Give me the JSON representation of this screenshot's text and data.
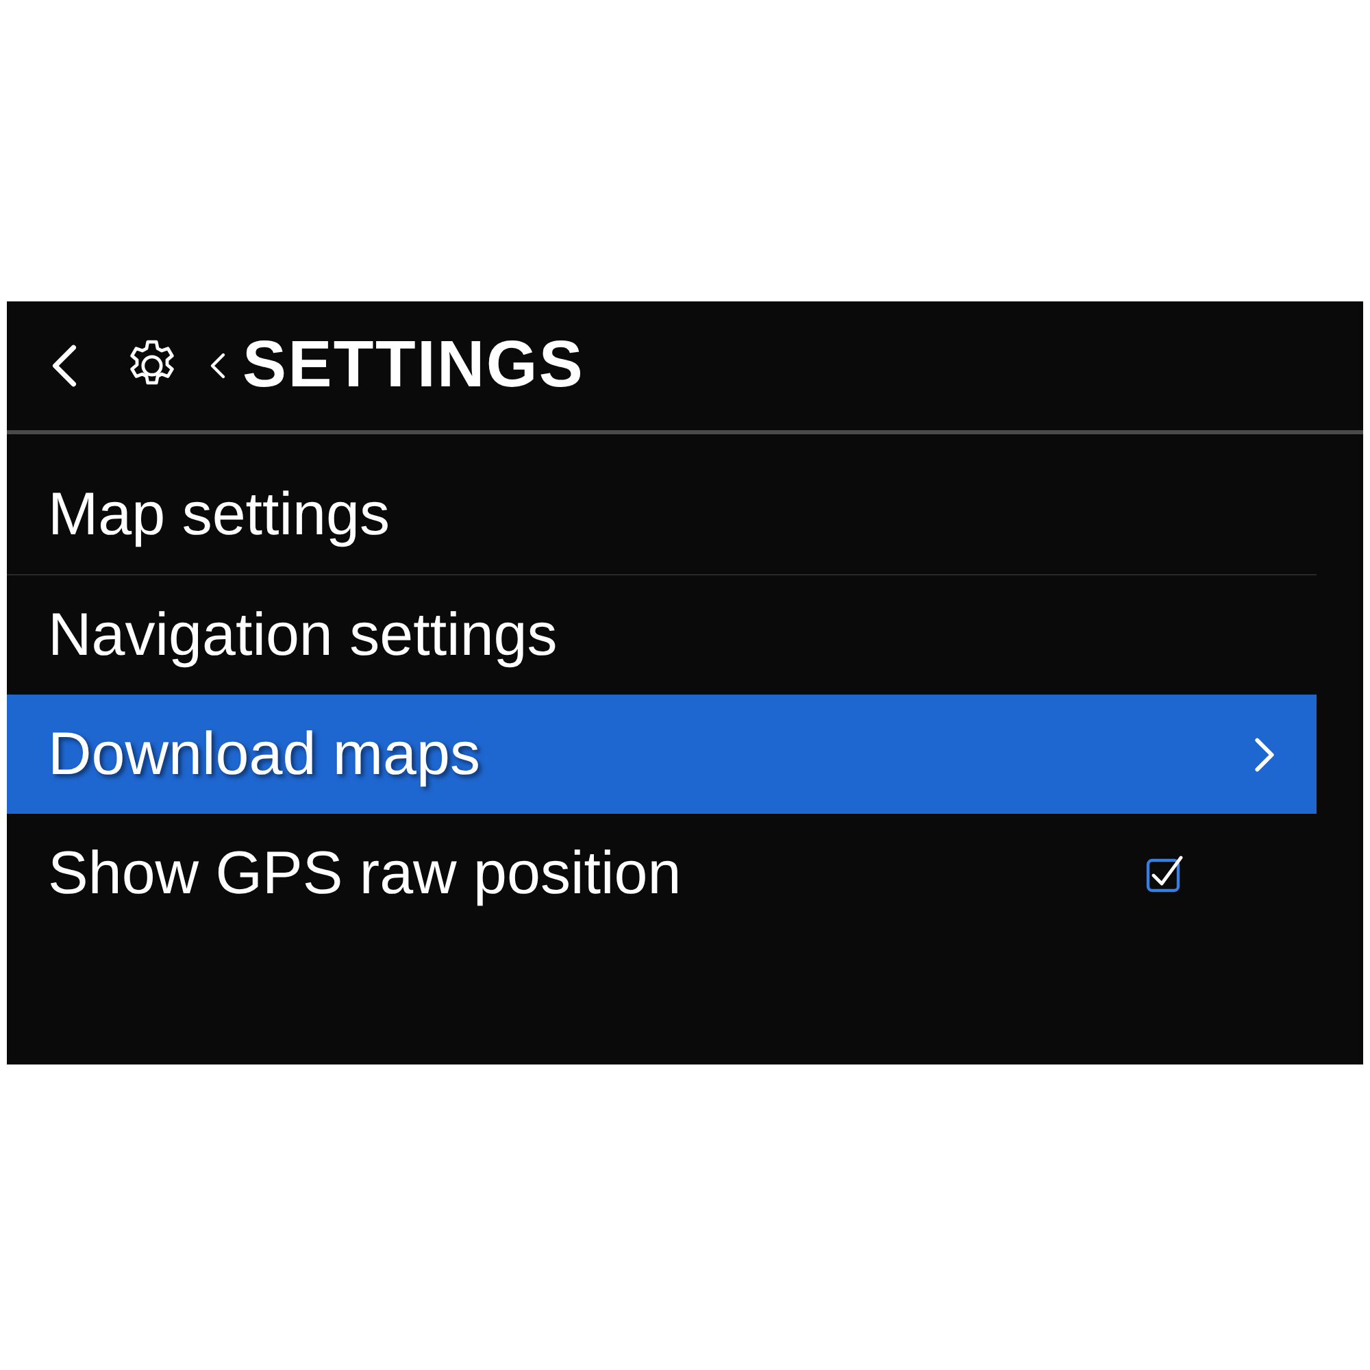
{
  "header": {
    "title": "SETTINGS"
  },
  "items": [
    {
      "kind": "link",
      "label": "Map settings",
      "selected": false
    },
    {
      "kind": "link",
      "label": "Navigation settings",
      "selected": false
    },
    {
      "kind": "link",
      "label": "Download maps",
      "selected": true
    },
    {
      "kind": "checkbox",
      "label": "Show GPS raw position",
      "selected": false,
      "checked": true
    }
  ]
}
